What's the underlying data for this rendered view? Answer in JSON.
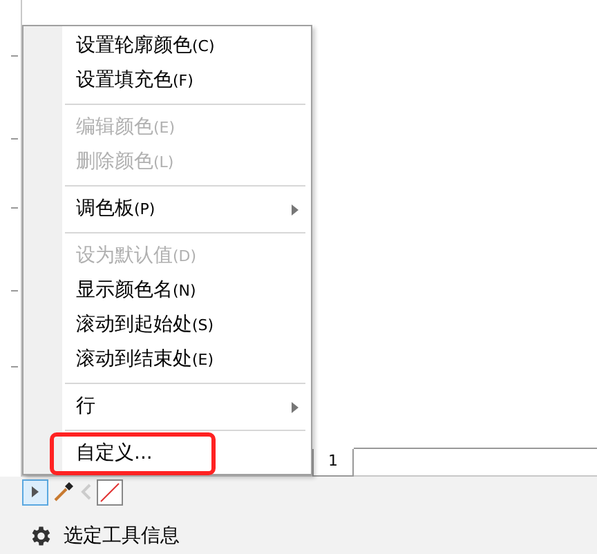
{
  "context_menu": {
    "items": [
      {
        "kind": "item",
        "label": "设置轮廓颜色",
        "accel": "(C)",
        "disabled": false,
        "submenu": false,
        "highlighted": false
      },
      {
        "kind": "item",
        "label": "设置填充色",
        "accel": "(F)",
        "disabled": false,
        "submenu": false,
        "highlighted": false
      },
      {
        "kind": "separator"
      },
      {
        "kind": "item",
        "label": "编辑颜色",
        "accel": "(E)",
        "disabled": true,
        "submenu": false,
        "highlighted": false
      },
      {
        "kind": "item",
        "label": "删除颜色",
        "accel": "(L)",
        "disabled": true,
        "submenu": false,
        "highlighted": false
      },
      {
        "kind": "separator"
      },
      {
        "kind": "item",
        "label": "调色板",
        "accel": "(P)",
        "disabled": false,
        "submenu": true,
        "highlighted": false
      },
      {
        "kind": "separator"
      },
      {
        "kind": "item",
        "label": "设为默认值",
        "accel": "(D)",
        "disabled": true,
        "submenu": false,
        "highlighted": false
      },
      {
        "kind": "item",
        "label": "显示颜色名",
        "accel": "(N)",
        "disabled": false,
        "submenu": false,
        "highlighted": false
      },
      {
        "kind": "item",
        "label": "滚动到起始处",
        "accel": "(S)",
        "disabled": false,
        "submenu": false,
        "highlighted": false
      },
      {
        "kind": "item",
        "label": "滚动到结束处",
        "accel": "(E)",
        "disabled": false,
        "submenu": false,
        "highlighted": false
      },
      {
        "kind": "separator"
      },
      {
        "kind": "item",
        "label": "行",
        "disabled": false,
        "submenu": true,
        "highlighted": false
      },
      {
        "kind": "separator"
      },
      {
        "kind": "item",
        "label": "自定义...",
        "disabled": false,
        "submenu": false,
        "highlighted": true
      }
    ]
  },
  "page_tab": {
    "label": "1"
  },
  "status_bar": {
    "text": "选定工具信息"
  }
}
